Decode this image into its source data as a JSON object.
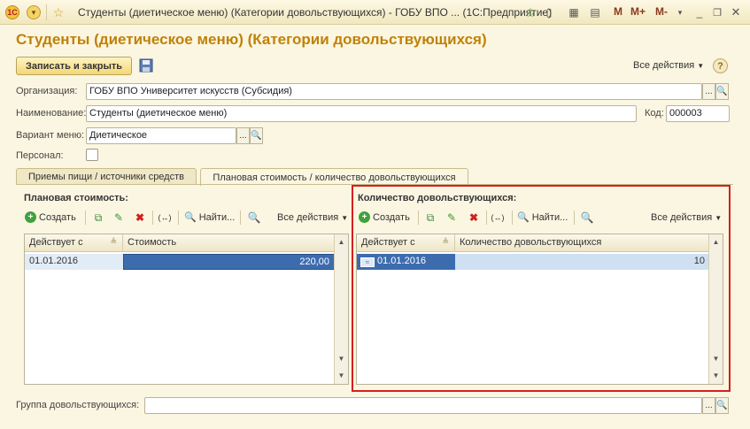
{
  "window": {
    "title": "Студенты (диетическое меню) (Категории довольствующихся) - ГОБУ ВПО ...  (1С:Предприятие)",
    "letters": [
      "M",
      "M+",
      "M-"
    ]
  },
  "form": {
    "title": "Студенты (диетическое меню) (Категории довольствующихся)",
    "save_close_label": "Записать и закрыть",
    "all_actions": "Все действия",
    "help": "?"
  },
  "fields": {
    "organization": {
      "label": "Организация:",
      "value": "ГОБУ ВПО Университет искусств (Субсидия)"
    },
    "name": {
      "label": "Наименование:",
      "value": "Студенты (диетическое меню)"
    },
    "code": {
      "label": "Код:",
      "value": "000003"
    },
    "menu_variant": {
      "label": "Вариант меню:",
      "value": "Диетическое"
    },
    "personnel": {
      "label": "Персонал:"
    },
    "group": {
      "label": "Группа довольствующихся:",
      "value": ""
    }
  },
  "tabs": [
    {
      "label": "Приемы пищи / источники средств",
      "active": false
    },
    {
      "label": "Плановая стоимость / количество довольствующихся",
      "active": true
    }
  ],
  "left_panel": {
    "title": "Плановая стоимость:",
    "toolbar": {
      "create": "Создать",
      "find": "Найти...",
      "all_actions": "Все действия"
    },
    "columns": [
      "Действует с",
      "Стоимость"
    ],
    "rows": [
      {
        "date": "01.01.2016",
        "value": "220,00"
      }
    ]
  },
  "right_panel": {
    "title": "Количество довольствующихся:",
    "toolbar": {
      "create": "Создать",
      "find": "Найти...",
      "all_actions": "Все действия"
    },
    "columns": [
      "Действует с",
      "Количество довольствующихся"
    ],
    "rows": [
      {
        "date": "01.01.2016",
        "value": "10"
      }
    ],
    "highlight_color": "#d42020"
  }
}
